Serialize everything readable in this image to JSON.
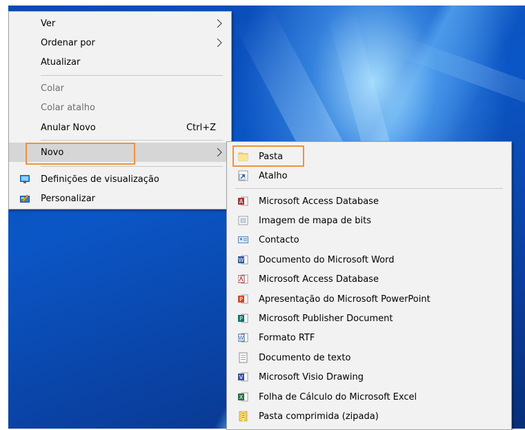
{
  "context_menu": {
    "items": [
      {
        "label": "Ver",
        "shortcut": "",
        "state": "normal",
        "icon": ""
      },
      {
        "label": "Ordenar por",
        "shortcut": "",
        "state": "normal",
        "icon": ""
      },
      {
        "label": "Atualizar",
        "shortcut": "",
        "state": "normal",
        "icon": ""
      },
      {
        "label": "Colar",
        "shortcut": "",
        "state": "disabled",
        "icon": ""
      },
      {
        "label": "Colar atalho",
        "shortcut": "",
        "state": "disabled",
        "icon": ""
      },
      {
        "label": "Anular Novo",
        "shortcut": "Ctrl+Z",
        "state": "normal",
        "icon": ""
      },
      {
        "label": "Novo",
        "shortcut": "",
        "state": "hover",
        "icon": ""
      },
      {
        "label": "Definições de visualização",
        "shortcut": "",
        "state": "normal",
        "icon": "display-settings-icon"
      },
      {
        "label": "Personalizar",
        "shortcut": "",
        "state": "normal",
        "icon": "personalize-icon"
      }
    ]
  },
  "new_submenu": {
    "items": [
      {
        "label": "Pasta",
        "icon": "folder-icon"
      },
      {
        "label": "Atalho",
        "icon": "shortcut-icon"
      },
      {
        "label": "Microsoft Access Database",
        "icon": "access-icon"
      },
      {
        "label": "Imagem de mapa de bits",
        "icon": "bitmap-icon"
      },
      {
        "label": "Contacto",
        "icon": "contact-icon"
      },
      {
        "label": "Documento do Microsoft Word",
        "icon": "word-icon"
      },
      {
        "label": "Microsoft Access Database",
        "icon": "access-icon"
      },
      {
        "label": "Apresentação do Microsoft PowerPoint",
        "icon": "powerpoint-icon"
      },
      {
        "label": "Microsoft Publisher Document",
        "icon": "publisher-icon"
      },
      {
        "label": "Formato RTF",
        "icon": "rtf-icon"
      },
      {
        "label": "Documento de texto",
        "icon": "text-document-icon"
      },
      {
        "label": "Microsoft Visio Drawing",
        "icon": "visio-icon"
      },
      {
        "label": "Folha de Cálculo do Microsoft Excel",
        "icon": "excel-icon"
      },
      {
        "label": "Pasta comprimida (zipada)",
        "icon": "zip-folder-icon"
      }
    ]
  },
  "colors": {
    "highlight_border": "#f0923a",
    "menu_background": "#f2f2f2",
    "hover_background": "#d6d6d6",
    "desktop_blue": "#0a49b4"
  }
}
